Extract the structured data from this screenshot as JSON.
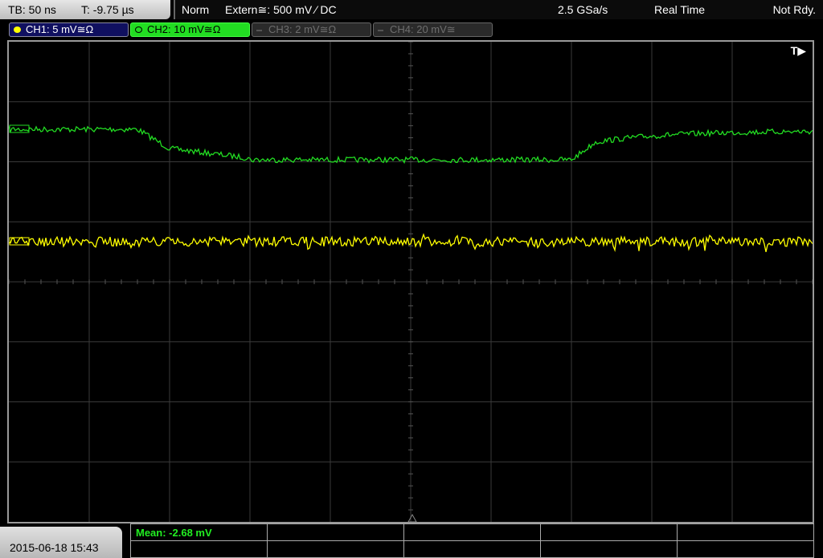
{
  "timebase": {
    "tb": "TB: 50 ns",
    "offset": "T: -9.75 µs"
  },
  "acquisition": {
    "mode": "Norm",
    "trigger": "Extern≅: 500 mV ⁄ DC",
    "rate": "2.5 GSa/s",
    "display_mode": "Real Time",
    "status": "Not Rdy."
  },
  "channels": [
    {
      "label": "CH1: 5 mV≅Ω",
      "color": "#ffff00",
      "active": true
    },
    {
      "label": "CH2: 10 mV≅Ω",
      "color": "#22dd22",
      "active": true,
      "selected": true
    },
    {
      "label": "CH3: 2 mV≅Ω",
      "color": "#555555",
      "active": false
    },
    {
      "label": "CH4: 20 mV≅",
      "color": "#555555",
      "active": false
    }
  ],
  "trigger_flag": "T▶",
  "datetime": "2015-06-18 15:43",
  "measurement": {
    "mean": "Mean: -2.68 mV"
  },
  "colors": {
    "grid": "#3a3a3a",
    "ch1": "#ffff00",
    "ch2": "#22dd22"
  }
}
